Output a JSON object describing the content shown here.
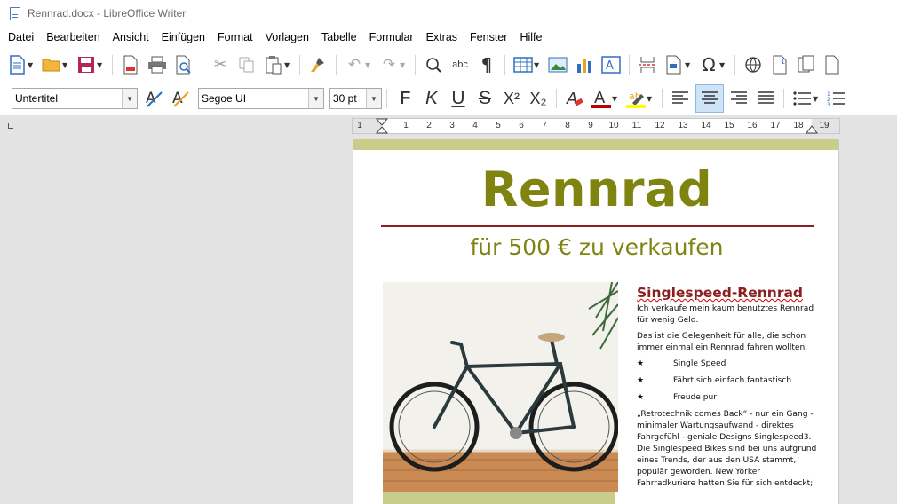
{
  "window": {
    "title": "Rennrad.docx - LibreOffice Writer"
  },
  "menu": [
    "Datei",
    "Bearbeiten",
    "Ansicht",
    "Einfügen",
    "Format",
    "Vorlagen",
    "Tabelle",
    "Formular",
    "Extras",
    "Fenster",
    "Hilfe"
  ],
  "toolbar2": {
    "paragraph_style": "Untertitel",
    "font_name": "Segoe UI",
    "font_size": "30 pt",
    "bold_label": "F",
    "italic_label": "K",
    "underline_label": "U",
    "strike_label": "S",
    "superscript_label": "X²",
    "subscript_label": "X₂"
  },
  "ruler": {
    "marks": [
      "1",
      "1",
      "2",
      "3",
      "4",
      "5",
      "6",
      "7",
      "8",
      "9",
      "10",
      "11",
      "12",
      "13",
      "14",
      "15",
      "16",
      "17",
      "18",
      "19"
    ]
  },
  "document": {
    "title": "Rennrad",
    "subtitle": "für 500 € zu verkaufen",
    "heading": "Singlespeed-Rennrad",
    "para1": "Ich verkaufe mein kaum benutztes Rennrad für wenig Geld.",
    "para2": "Das ist die Gelegenheit für alle, die schon immer einmal ein Rennrad fahren wollten.",
    "bullets": [
      "Single Speed",
      "Fährt sich einfach fantastisch",
      "Freude pur"
    ],
    "para3": "„Retrotechnik comes Back“ - nur ein Gang - minimaler Wartungsaufwand - direktes Fahrgefühl - geniale Designs Singlespeed3. Die Singlespeed Bikes sind bei uns auf­grund eines Trends, der aus den USA stammt, populär geworden. New Yorker Fahrradkuriere hatten Sie für sich entdeckt;"
  },
  "colors": {
    "title": "#7f8410",
    "rule": "#8b1f1f",
    "band": "#c9cd8a",
    "heading": "#8b1f1f"
  }
}
